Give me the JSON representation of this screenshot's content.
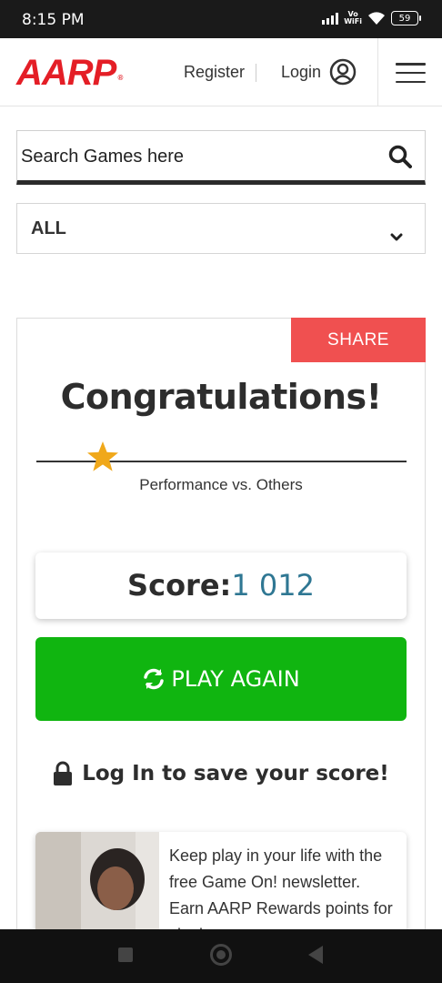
{
  "status": {
    "time": "8:15 PM",
    "vo": "Vo",
    "wifi": "WiFi",
    "battery": "59"
  },
  "header": {
    "logo": "AARP",
    "register": "Register",
    "login": "Login"
  },
  "search": {
    "placeholder": "Search Games here"
  },
  "filter": {
    "selected": "ALL"
  },
  "card": {
    "share": "SHARE",
    "title": "Congratulations!",
    "performance_label": "Performance vs. Others",
    "performance_percentile": 0.18,
    "score_label": "Score:",
    "score_value": "1 012",
    "play_again": "PLAY AGAIN",
    "login_save": "Log In to save your score!",
    "promo_text": "Keep play in your life with the free Game On! newsletter. Earn AARP Rewards points for signing"
  },
  "colors": {
    "brand_red": "#e41e26",
    "share_bg": "#f05050",
    "play_green": "#10b510",
    "score_blue": "#2f7793",
    "star": "#f0a81a"
  },
  "icons": {
    "search": "search-icon",
    "user": "user-circle-icon",
    "menu": "hamburger-menu-icon",
    "chevron": "chevron-down-icon",
    "star": "star-icon",
    "refresh": "refresh-icon",
    "lock": "lock-icon"
  }
}
